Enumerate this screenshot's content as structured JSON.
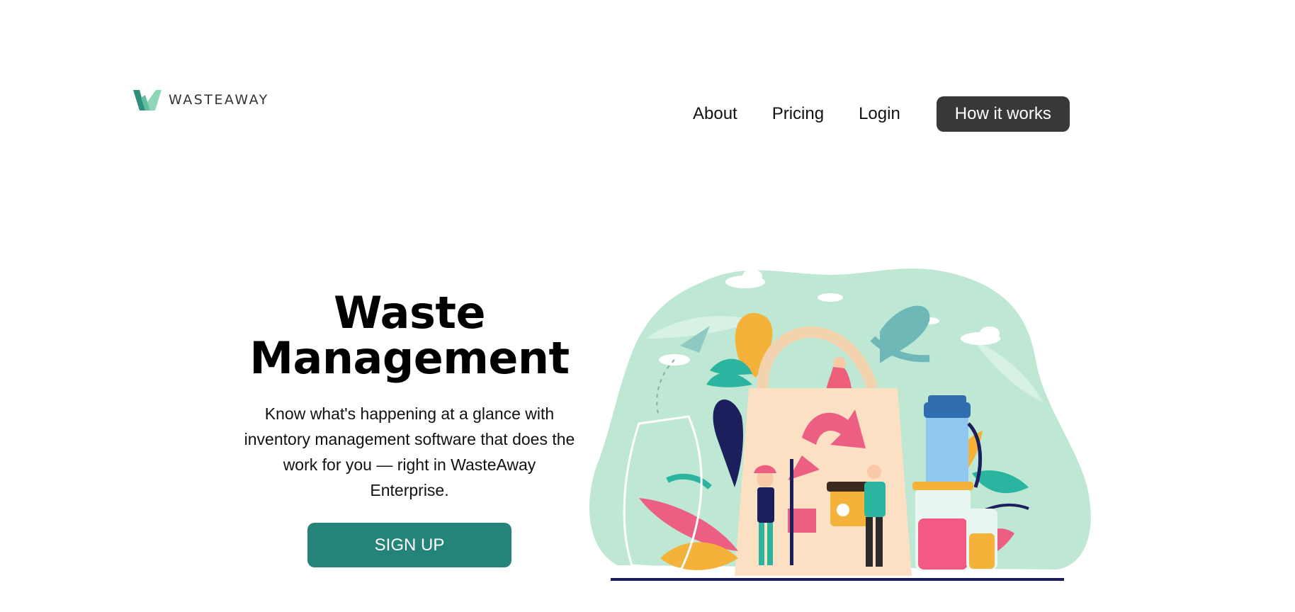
{
  "header": {
    "logo_text": "WASTEAWAY",
    "nav": {
      "about": "About",
      "pricing": "Pricing",
      "login": "Login",
      "how_it_works": "How it works"
    }
  },
  "hero": {
    "title_line1": "Waste",
    "title_line2": "Management",
    "description": "Know what's happening at a glance with inventory management software that does the work for you — right in WasteAway Enterprise.",
    "signup_label": "SIGN UP"
  },
  "colors": {
    "accent": "#25847a",
    "nav_button": "#383838",
    "blob": "#bfe8d4"
  }
}
